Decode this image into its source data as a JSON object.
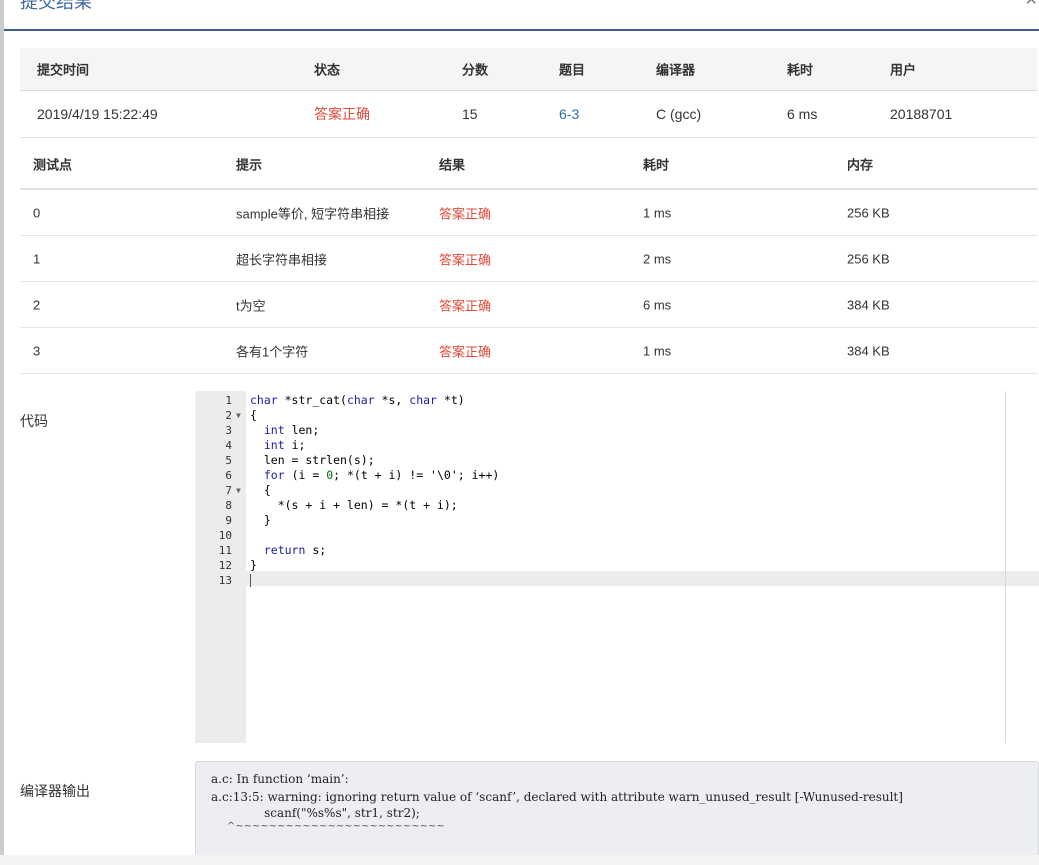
{
  "modal": {
    "title": "提交结果",
    "close_icon": "close-icon"
  },
  "summary": {
    "headers": [
      "提交时间",
      "状态",
      "分数",
      "题目",
      "编译器",
      "耗时",
      "用户"
    ],
    "row": {
      "time": "2019/4/19 15:22:49",
      "status": "答案正确",
      "score": "15",
      "problem": "6-3",
      "compiler": "C (gcc)",
      "elapsed": "6 ms",
      "user": "20188701"
    }
  },
  "tests": {
    "headers": [
      "测试点",
      "提示",
      "结果",
      "耗时",
      "内存"
    ],
    "rows": [
      {
        "id": "0",
        "hint": "sample等价, 短字符串相接",
        "result": "答案正确",
        "time": "1 ms",
        "memory": "256 KB"
      },
      {
        "id": "1",
        "hint": "超长字符串相接",
        "result": "答案正确",
        "time": "2 ms",
        "memory": "256 KB"
      },
      {
        "id": "2",
        "hint": "t为空",
        "result": "答案正确",
        "time": "6 ms",
        "memory": "384 KB"
      },
      {
        "id": "3",
        "hint": "各有1个字符",
        "result": "答案正确",
        "time": "1 ms",
        "memory": "384 KB"
      }
    ]
  },
  "code_section": {
    "label": "代码",
    "line_numbers": [
      "1",
      "2",
      "3",
      "4",
      "5",
      "6",
      "7",
      "8",
      "9",
      "10",
      "11",
      "12",
      "13"
    ]
  },
  "compiler_section": {
    "label": "编译器输出",
    "lines": [
      "a.c: In function ‘main’:",
      "a.c:13:5: warning: ignoring return value of ‘scanf’, declared with attribute warn_unused_result [-Wunused-result]",
      "     scanf(\"%s%s\", str1, str2);",
      "     ^~~~~~~~~~~~~~~~~~~~~~~~~~"
    ]
  },
  "colors": {
    "accent": "#3f6aa6",
    "success": "#e04b3a",
    "link": "#2a6fb0"
  }
}
